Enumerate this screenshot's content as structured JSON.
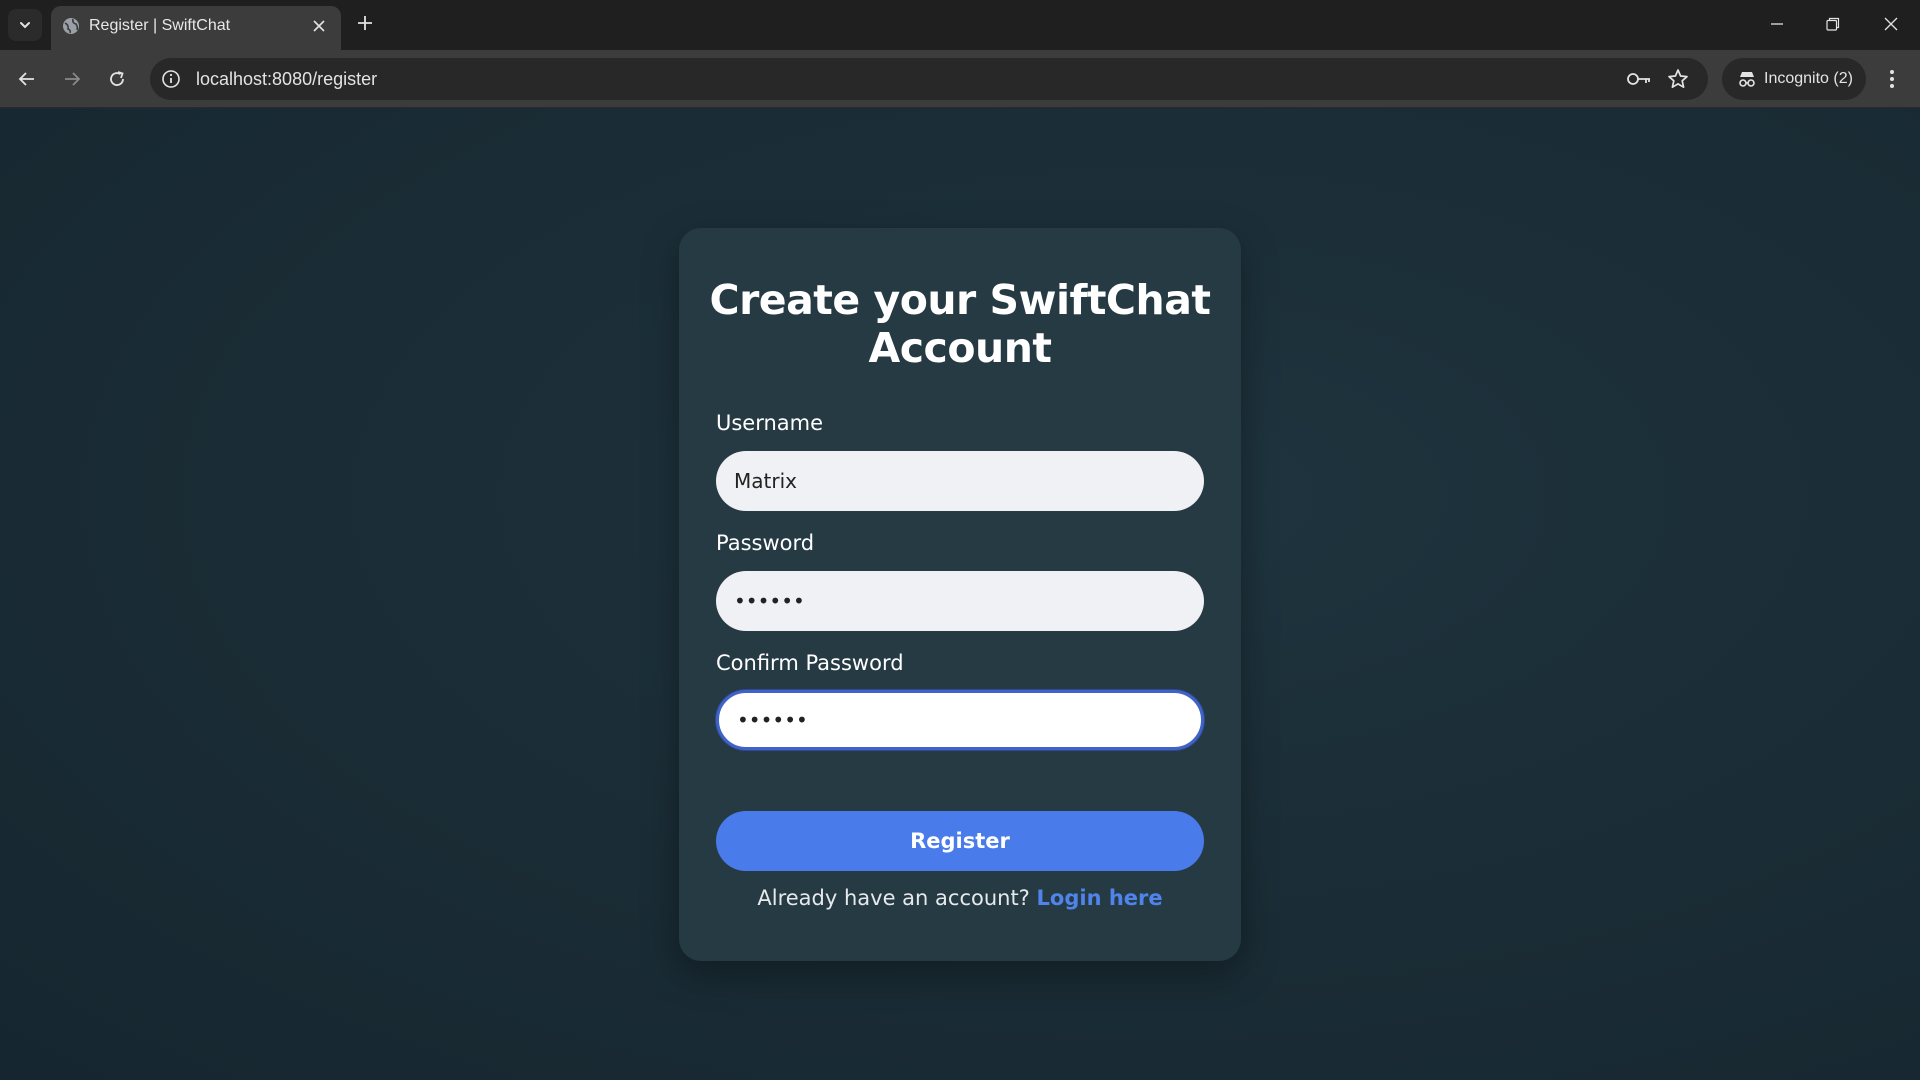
{
  "browser": {
    "tab_title": "Register | SwiftChat",
    "url": "localhost:8080/register",
    "profile_label": "Incognito (2)"
  },
  "page": {
    "title": "Create your SwiftChat Account",
    "username": {
      "label": "Username",
      "value": "Matrix"
    },
    "password": {
      "label": "Password",
      "value": "••••••"
    },
    "confirm_password": {
      "label": "Confirm Password",
      "value": "••••••"
    },
    "register_button": "Register",
    "footer_prompt": "Already have an account?",
    "login_link": "Login here"
  },
  "colors": {
    "background": "#1b2a33",
    "card": "#263a44",
    "accent": "#4a7bea",
    "link": "#4f85ea"
  }
}
